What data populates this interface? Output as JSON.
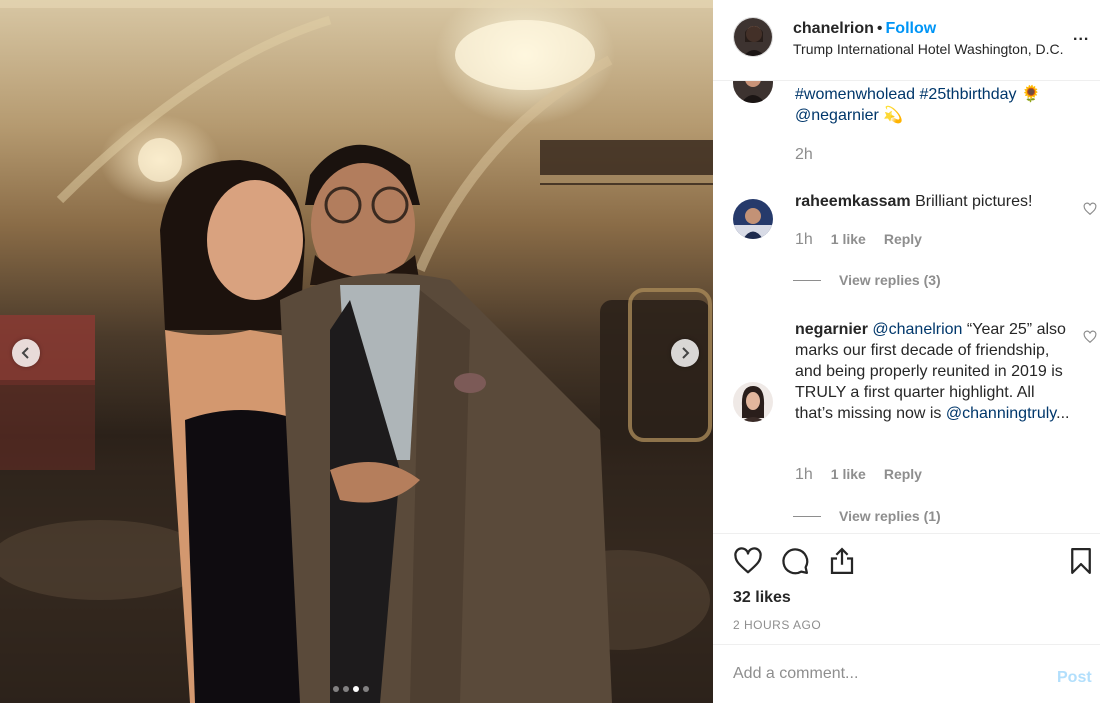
{
  "header": {
    "username": "chanelrion",
    "separator": "•",
    "follow_label": "Follow",
    "location": "Trump International Hotel Washington, D.C.",
    "more_label": "..."
  },
  "caption": {
    "tags_line": "#womenwholead #25thbirthday",
    "mention": "@negarnier",
    "emoji_1": "🌻",
    "emoji_2": "💫",
    "time": "2h"
  },
  "comments": [
    {
      "username": "raheemkassam",
      "text": "Brilliant pictures!",
      "time": "1h",
      "likes": "1 like",
      "reply_label": "Reply",
      "view_replies": "View replies (3)"
    },
    {
      "username": "negarnier",
      "mention_1": "@chanelrion",
      "text_part": "“Year 25” also marks our first decade of friendship, and being properly reunited in 2019 is TRULY a first quarter highlight. All that’s missing now is",
      "mention_2": "@channingtruly",
      "ellipsis": "...",
      "time": "1h",
      "likes": "1 like",
      "reply_label": "Reply",
      "view_replies": "View replies (1)"
    }
  ],
  "post": {
    "likes": "32 likes",
    "timestamp": "2 HOURS AGO"
  },
  "composer": {
    "placeholder": "Add a comment...",
    "post_label": "Post"
  },
  "carousel": {
    "total": 4,
    "active_index": 2
  },
  "colors": {
    "link_blue": "#0095f6",
    "mention_blue": "#00376b",
    "muted_gray": "#8e8e8e",
    "post_disabled": "#b2dffc"
  }
}
